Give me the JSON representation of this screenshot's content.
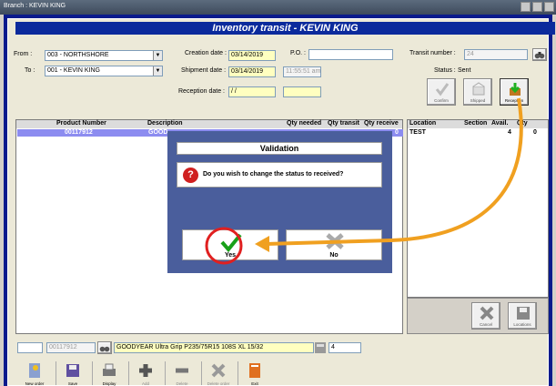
{
  "window": {
    "title": "Branch : KEVIN KING"
  },
  "header": {
    "title": "Inventory transit - KEVIN KING"
  },
  "form": {
    "from_label": "From :",
    "from_value": "003 - NORTHSHORE",
    "to_label": "To :",
    "to_value": "001 - KEVIN KING",
    "creation_label": "Creation date :",
    "creation_value": "03/14/2019",
    "po_label": "P.O. :",
    "po_value": "",
    "shipment_label": "Shipment date :",
    "shipment_value": "03/14/2019",
    "shipment_time": "11:55:51 am",
    "reception_label": "Reception date :",
    "reception_value": " / /",
    "reception_time": "",
    "transit_label": "Transit number :",
    "transit_value": "24",
    "status_label": "Status :",
    "status_value": "Sent"
  },
  "top_actions": {
    "confirm": "Confirm",
    "shipped": "Shipped",
    "reception": "Reception"
  },
  "items_grid": {
    "columns": [
      "Product Number",
      "Description",
      "Qty needed",
      "Qty transit",
      "Qty receive"
    ],
    "row": {
      "product": "00117912",
      "description": "GOOD",
      "qty_receive": "0"
    }
  },
  "location_grid": {
    "columns": [
      "Location",
      "Section",
      "Avail.",
      "Qty"
    ],
    "row": {
      "location": "TEST",
      "avail": "4",
      "qty": "0"
    }
  },
  "location_actions": {
    "cancel": "Cancel",
    "locations": "Locations"
  },
  "dialog": {
    "title": "Validation",
    "message": "Do you wish to change the status to received?",
    "yes": "Yes",
    "no": "No"
  },
  "entry": {
    "product": "00117912",
    "description": "GOODYEAR Ultra Grip P235/75R15 108S XL 15/32",
    "qty": "4"
  },
  "toolbar": {
    "new_order": "New order",
    "save": "Save",
    "display": "Display",
    "add": "Add",
    "delete": "Delete",
    "delete_order": "Delete order",
    "exit": "Exit"
  },
  "colors": {
    "header": "#0b2a9c",
    "dialog": "#4a5e9c",
    "selection": "#8c8cf0",
    "arrow": "#f0a020",
    "highlight": "#e02020"
  }
}
